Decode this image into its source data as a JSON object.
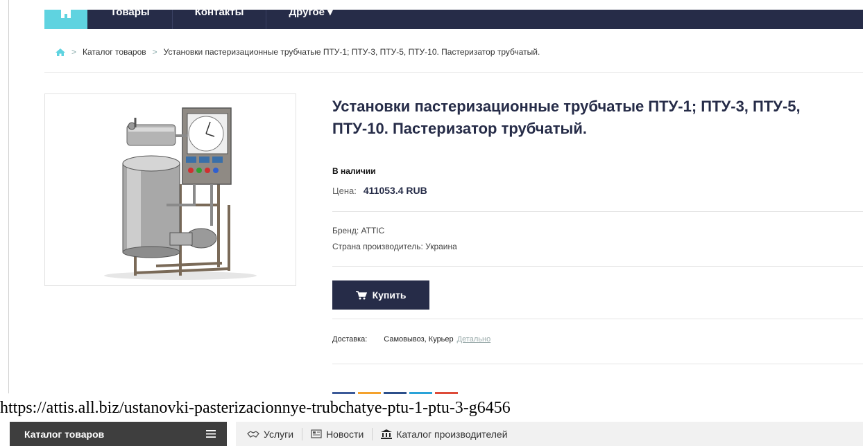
{
  "nav": {
    "items": [
      "Товары",
      "Контакты",
      "Другое ▾"
    ]
  },
  "breadcrumb": {
    "items": [
      "Каталог товаров",
      "Установки пастеризационные трубчатые ПТУ-1; ПТУ-3, ПТУ-5, ПТУ-10. Пастеризатор трубчатый."
    ]
  },
  "product": {
    "title": "Установки пастеризационные трубчатые ПТУ-1; ПТУ-3, ПТУ-5, ПТУ-10. Пастеризатор трубчатый.",
    "stock": "В наличии",
    "price_label": "Цена:",
    "price_value": "411053.4 RUB",
    "brand": "Бренд:  ATTIC",
    "country": "Страна производитель:  Украина",
    "buy_label": "Купить",
    "delivery_label": "Доставка:",
    "delivery_value": "Самовывоз,  Курьер",
    "delivery_details": "Детально"
  },
  "url": "https://attis.all.biz/ustanovki-pasterizacionnye-trubchatye-ptu-1-ptu-3-g6456",
  "bottom": {
    "catalog": "Каталог товаров",
    "services": "Услуги",
    "news": "Новости",
    "manufacturers": "Каталог производителей"
  },
  "colors": {
    "nav_bg": "#262c48",
    "accent": "#5fd3e0",
    "bottom_dark": "#3e3e3e"
  },
  "icons": [
    "home-icon",
    "cart-icon",
    "menu-icon",
    "handshake-icon",
    "newspaper-icon",
    "bank-icon"
  ]
}
